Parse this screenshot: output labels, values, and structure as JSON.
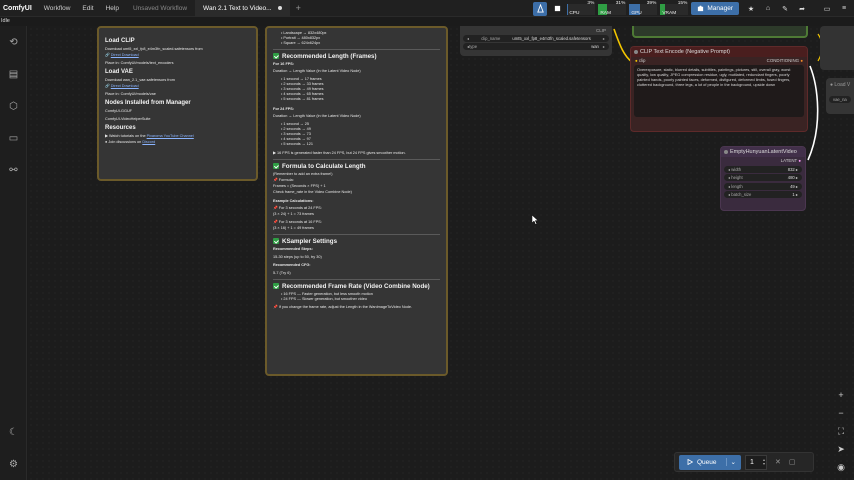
{
  "app": {
    "brand": "ComfyUI",
    "menu": [
      "Workflow",
      "Edit",
      "Help"
    ],
    "tabs": [
      {
        "label": "Unsaved Workflow",
        "active": false
      },
      {
        "label": "Wan 2.1 Text to Video...",
        "active": true
      }
    ],
    "status": "Idle",
    "manager_label": "Manager",
    "meters": [
      {
        "name": "CPU",
        "pct": "3%",
        "value": 0.03,
        "color": "#3d6fa8"
      },
      {
        "name": "RAM",
        "pct": "31%",
        "value": 0.31,
        "color": "#2f9e44"
      },
      {
        "name": "GPU",
        "pct": "39%",
        "value": 0.39,
        "color": "#3d6fa8"
      },
      {
        "name": "VRAM",
        "pct": "15%",
        "value": 0.15,
        "color": "#2f9e44"
      }
    ]
  },
  "note_left": {
    "load_clip_title": "Load CLIP",
    "load_clip_text": "Download umt5_xxl_fp8_e4m3fn_scaled.safetensors from",
    "load_clip_link": "Direct Download",
    "load_clip_place": "Place in: ComfyUI/models/text_encoders",
    "load_vae_title": "Load VAE",
    "load_vae_text": "Download wan_2.1_vae.safetensors from",
    "load_vae_link": "Direct Download",
    "load_vae_place": "Place in: ComfyUI/models/vae",
    "nodes_title": "Nodes Installed from Manager",
    "nodes_items": [
      "ComfyUI-GGUF",
      "ComfyUI-VideoHelperSuite"
    ],
    "resources_title": "Resources",
    "resources_items": [
      {
        "text": "Watch tutorials on the ",
        "link": "Pixaroma YouTube Channel"
      },
      {
        "text": "Join discussions on ",
        "link": "Discord"
      }
    ]
  },
  "note_main": {
    "top_items": [
      "Landscape → 832x480px",
      "Portrait → 480x832px",
      "Square → 624x624px"
    ],
    "rec_length_title": "Recommended Length (Frames)",
    "fps16_label": "For 16 FPS:",
    "duration_label_16": "Duration → Length Value (in the Latent Video Node)",
    "fps16_items": [
      "1 second → 17 frames",
      "2 seconds → 33 frames",
      "3 seconds → 49 frames",
      "4 seconds → 65 frames",
      "5 seconds → 81 frames"
    ],
    "fps24_label": "For 24 FPS:",
    "duration_label_24": "Duration → Length Value (in the Latent Video Node)",
    "fps24_items": [
      "1 second → 25",
      "2 seconds → 49",
      "3 seconds → 73",
      "4 seconds → 97",
      "5 seconds → 121"
    ],
    "fps_note": "16 FPS is generated faster than 24 FPS, but 24 FPS gives smoother motion.",
    "formula_title": "Formula to Calculate Length",
    "formula_remember": "(Remember to add an extra frame!)",
    "formula_label": "Formula:",
    "formula": "Frames = (Seconds × FPS) + 1",
    "formula_check": "Check frame_rate in the Video Combine Node)",
    "example_title": "Example Calculations:",
    "example_24_label": "For 3 seconds at 24 FPS:",
    "example_24": "(3 × 24) + 1 = 73 frames",
    "example_16_label": "For 3 seconds at 16 FPS:",
    "example_16": "(3 × 16) + 1 = 49 frames",
    "ksampler_title": "KSampler Settings",
    "steps_label": "Recommended Steps:",
    "steps_value": "15-30 steps (up to 50, try 30)",
    "cfg_label": "Recommended CFG:",
    "cfg_value": "5-7 (Try 6)",
    "framerate_title": "Recommended Frame Rate (Video Combine Node)",
    "framerate_items": [
      "16 FPS — Faster generation, but less smooth motion",
      "24 FPS — Slower generation, but smoother video"
    ],
    "framerate_note": "If you change the frame rate, adjust the Length in the WanImageToVideo Node."
  },
  "clip_loader": {
    "clip_name_label": "clip_name",
    "clip_name_value": "umt5_xxl_fp8_e4m3fn_scaled.safetensors",
    "type_label": "type",
    "type_value": "wan",
    "output": "CLIP"
  },
  "clip_neg": {
    "title": "CLIP Text Encode (Negative Prompt)",
    "input": "clip",
    "output": "CONDITIONING",
    "text": "Overexposure, static, blurred details, subtitles, paintings, pictures, still, overall gray, worst quality, low quality, JPEG compression residue, ugly, mutilated, redundant fingers, poorly painted hands, poorly painted faces, deformed, disfigured, deformed limbs, fused fingers, cluttered background, three legs, a lot of people in the background, upside down"
  },
  "latent": {
    "title": "EmptyHunyuanLatentVideo",
    "output": "LATENT",
    "widgets": [
      {
        "label": "width",
        "value": "832"
      },
      {
        "label": "height",
        "value": "480"
      },
      {
        "label": "length",
        "value": "49"
      },
      {
        "label": "batch_size",
        "value": "1"
      }
    ]
  },
  "right_partial": {
    "label": "Load V",
    "sub": "vae_na"
  },
  "queue": {
    "label": "Queue",
    "count": "1"
  }
}
